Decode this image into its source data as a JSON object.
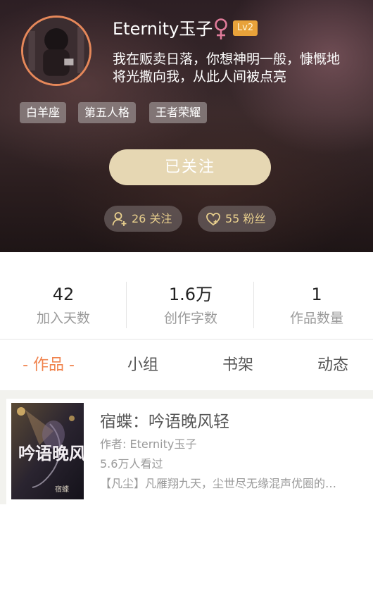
{
  "profile": {
    "username": "Eternity玉子",
    "gender_icon": "female-icon",
    "level": "Lv2",
    "signature_line1": "我在贩卖日落，你想神明一般，慷慨地",
    "signature_line2": "将光撒向我，从此人间被点亮",
    "tags": [
      "白羊座",
      "第五人格",
      "王者荣耀"
    ],
    "follow_button": "已关注",
    "following": "26 关注",
    "followers": "55 粉丝"
  },
  "stats": [
    {
      "value": "42",
      "label": "加入天数"
    },
    {
      "value": "1.6万",
      "label": "创作字数"
    },
    {
      "value": "1",
      "label": "作品数量"
    }
  ],
  "tabs": [
    "- 作品 -",
    "小组",
    "书架",
    "动态"
  ],
  "works": [
    {
      "title": "宿蝶：吟语晚风轻",
      "author": "作者: Eternity玉子",
      "views": "5.6万人看过",
      "description": "【凡尘】凡雁翔九天，尘世尽无缘混声优圈的…",
      "cover_text": "吟语晚风轻",
      "cover_subtext": "宿蝶"
    }
  ],
  "colors": {
    "accent": "#f0834d",
    "follow_button": "#e6d7b3",
    "pill_text": "#e8cf8d",
    "level_badge": "#e8a23a",
    "gender_icon": "#e07b9a"
  }
}
